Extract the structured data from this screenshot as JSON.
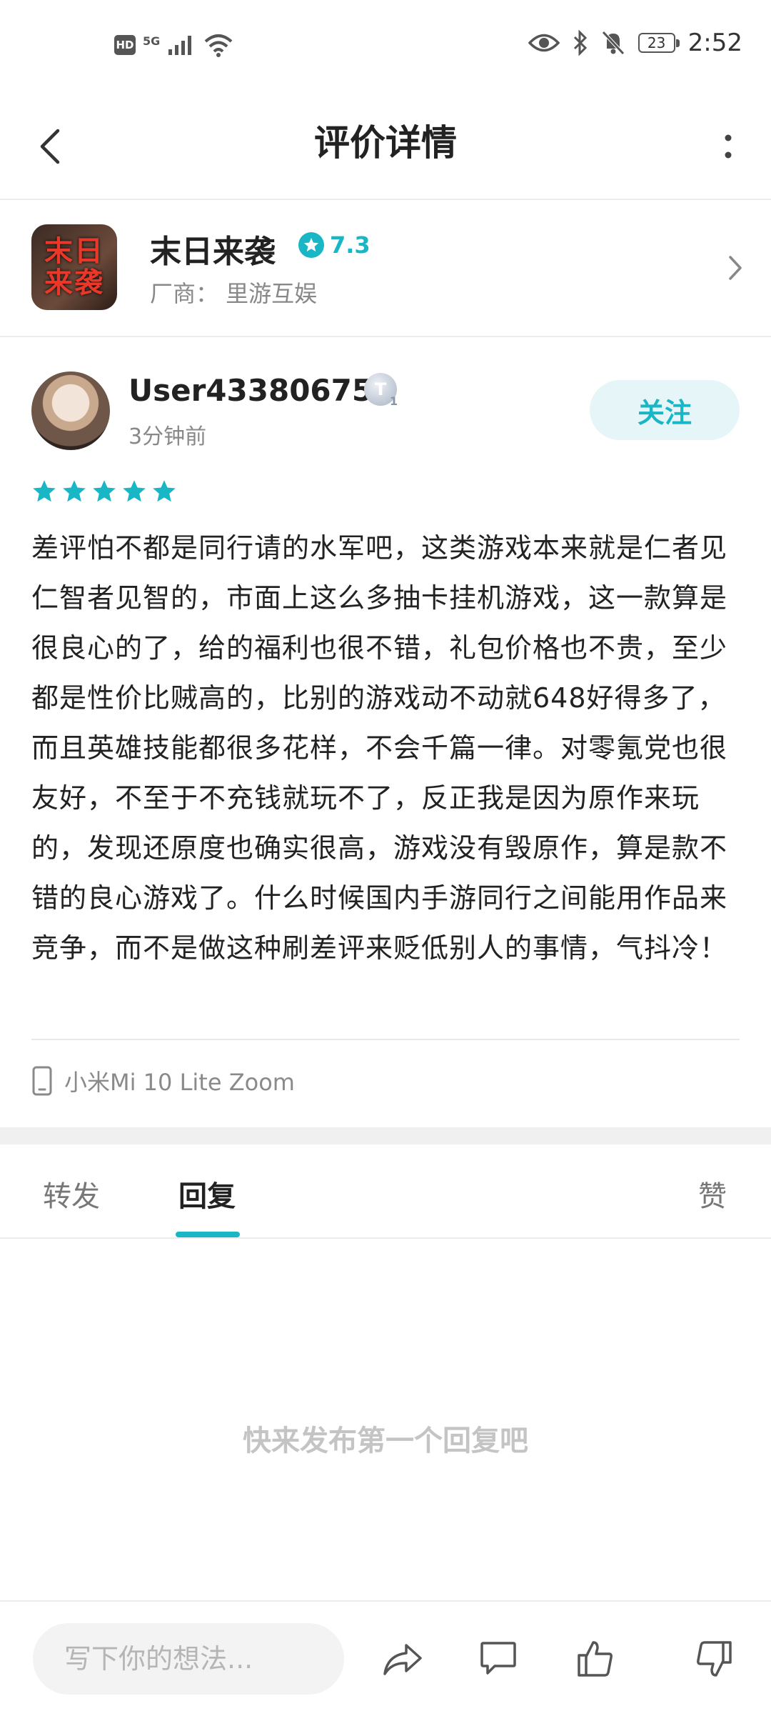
{
  "status_bar": {
    "hd": "HD",
    "network": "5G",
    "battery": "23",
    "time": "2:52"
  },
  "header": {
    "title": "评价详情"
  },
  "game": {
    "name": "末日来袭",
    "icon_text": "末日来袭",
    "rating": "7.3",
    "vendor": "厂商：  里游互娱"
  },
  "review": {
    "username": "User433806757",
    "level_badge": "T",
    "level_sub": "1",
    "time_ago": "3分钟前",
    "follow_label": "关注",
    "stars": 5,
    "text": "差评怕不都是同行请的水军吧，这类游戏本来就是仁者见仁智者见智的，市面上这么多抽卡挂机游戏，这一款算是很良心的了，给的福利也很不错，礼包价格也不贵，至少都是性价比贼高的，比别的游戏动不动就648好得多了，而且英雄技能都很多花样，不会千篇一律。对零氪党也很友好，不至于不充钱就玩不了，反正我是因为原作来玩的，发现还原度也确实很高，游戏没有毁原作，算是款不错的良心游戏了。什么时候国内手游同行之间能用作品来竞争，而不是做这种刷差评来贬低别人的事情，气抖冷！",
    "device": "小米Mi 10 Lite Zoom"
  },
  "tabs": {
    "forward": "转发",
    "reply": "回复",
    "like": "赞"
  },
  "empty_state": "快来发布第一个回复吧",
  "bottom_bar": {
    "input_placeholder": "写下你的想法..."
  },
  "colors": {
    "accent": "#19b6c6",
    "follow_bg": "#e6f6f8"
  }
}
